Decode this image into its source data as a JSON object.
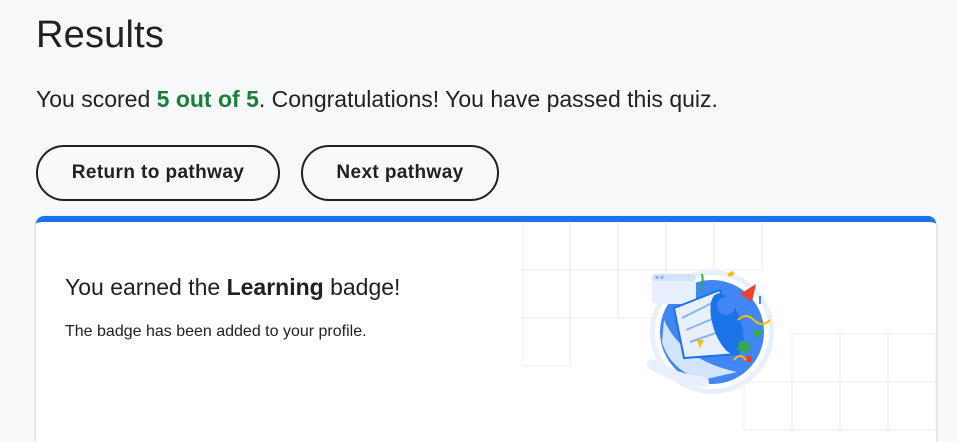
{
  "page": {
    "title": "Results"
  },
  "score": {
    "prefix": "You scored ",
    "value": "5 out of 5",
    "suffix": ". Congratulations! You have passed this quiz."
  },
  "actions": {
    "return_label": "Return to pathway",
    "next_label": "Next pathway"
  },
  "badge_card": {
    "heading_prefix": "You earned the ",
    "badge_name": "Learning",
    "heading_suffix": " badge!",
    "subtext": "The badge has been added to your profile.",
    "icon": "learning-badge-icon"
  },
  "colors": {
    "accent_blue": "#1a73e8",
    "score_green": "#188038",
    "text": "#202124",
    "background": "#f8f9fa"
  }
}
